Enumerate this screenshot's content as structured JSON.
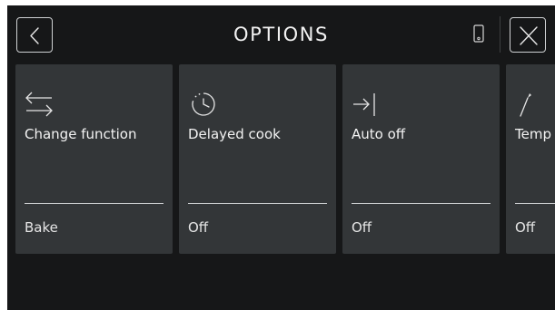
{
  "header": {
    "title": "OPTIONS",
    "back_icon": "chevron-left-icon",
    "remote_icon": "smartphone-icon",
    "close_icon": "close-icon"
  },
  "cards": [
    {
      "icon": "swap-arrows-icon",
      "label": "Change function",
      "value": "Bake"
    },
    {
      "icon": "delay-timer-icon",
      "label": "Delayed cook",
      "value": "Off"
    },
    {
      "icon": "arrow-to-bar-icon",
      "label": "Auto off",
      "value": "Off"
    },
    {
      "icon": "probe-icon",
      "label": "Temp",
      "value": "Off"
    }
  ],
  "colors": {
    "background": "#161718",
    "card": "#333638",
    "text": "#f2f2f2",
    "rule": "#c9cbcd"
  }
}
